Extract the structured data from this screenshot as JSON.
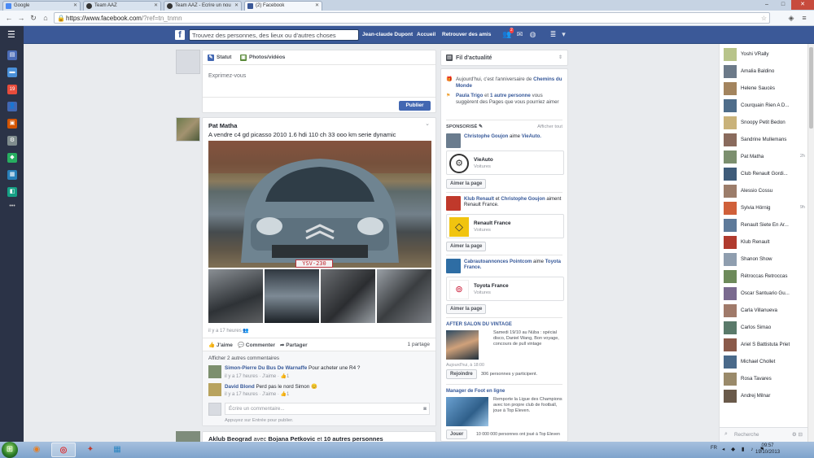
{
  "browser": {
    "tabs": [
      {
        "label": "Google",
        "icon": "google-icon",
        "active": false
      },
      {
        "label": "Team AAZ",
        "icon": "team-icon",
        "active": false
      },
      {
        "label": "Team AAZ - Ecrire un nou",
        "icon": "team-icon",
        "active": false
      },
      {
        "label": "(2) Facebook",
        "icon": "facebook-icon",
        "active": true
      }
    ],
    "url_host": "https://www.facebook.com",
    "url_path": "/?ref=tn_tnmn"
  },
  "topbar": {
    "search_placeholder": "Trouvez des personnes, des lieux ou d'autres choses",
    "user_name": "Jean-claude Dupont",
    "home_label": "Accueil",
    "find_friends_label": "Retrouver des amis",
    "friend_requests_count": "2"
  },
  "composer": {
    "tab_status": "Statut",
    "tab_photos": "Photos/vidéos",
    "placeholder": "Exprimez-vous",
    "publish_label": "Publier"
  },
  "post": {
    "author": "Pat Matha",
    "text": "A vendre c4 gd picasso 2010 1.6 hdi 110 ch 33 ooo km serie dynamic",
    "plate": "YSV-230",
    "time": "il y a 17 heures",
    "like_label": "J'aime",
    "comment_label": "Commenter",
    "share_label": "Partager",
    "share_count": "1 partage",
    "show_more_comments": "Afficher 2 autres commentaires",
    "comments": [
      {
        "author": "Simon-Pierre Du Bus De Warnaffe",
        "text": "Pour acheter une R4 ?",
        "time": "il y a 17 heures",
        "like": "J'aime",
        "likes": "1"
      },
      {
        "author": "David Blond",
        "text": "Perd pas le nord Simon 😊",
        "time": "il y a 17 heures",
        "like": "J'aime",
        "likes": "1"
      }
    ],
    "comment_placeholder": "Écrire un commentaire...",
    "enter_hint": "Appuyez sur Entrée pour publier."
  },
  "post2": {
    "author": "Aklub Beograd",
    "with_text": "avec",
    "tagged": "Bojana Petkovic",
    "and_text": "et",
    "others": "10 autres personnes"
  },
  "feed": {
    "title": "Fil d'actualité",
    "birthday_pre": "Aujourd'hui, c'est l'anniversaire de",
    "birthday_name": "Chemins du Monde",
    "suggest_name": "Paula Trigo",
    "suggest_mid": "et",
    "suggest_others": "1 autre personne",
    "suggest_rest": "vous suggèrent des Pages que vous pourriez aimer",
    "sponsored_label": "SPONSORISÉ",
    "show_all": "Afficher tout",
    "pages": [
      {
        "line_a": "Christophe Goujon",
        "line_verb": "aime",
        "line_b": "VieAuto.",
        "line_b2": "",
        "name": "VieAuto",
        "category": "Voitures",
        "like": "Aimer la page"
      },
      {
        "line_a": "Klub Renault",
        "line_verb": "et",
        "line_b": "Christophe Goujon",
        "line_b2": "aiment Renault France.",
        "name": "Renault France",
        "category": "Voitures",
        "like": "Aimer la page"
      },
      {
        "line_a": "Cabrautoannonces Pointcom",
        "line_verb": "aime",
        "line_b": "Toyota France.",
        "line_b2": "",
        "name": "Toyota France",
        "category": "Voitures",
        "like": "Aimer la page"
      }
    ],
    "event_title": "AFTER SALON DU VINTAGE",
    "event_desc": "Samedi 19/10 au Nüba : spécial disco, Daniel Wang, Bon voyage, concours de pull vintage",
    "event_time": "Aujourd'hui, à 18:00",
    "event_join": "Rejoindre",
    "event_participants": "306 personnes y participent.",
    "game_title": "Manager de Foot en ligne",
    "game_desc": "Remporte la Ligue des Champions avec ton propre club de football, joue à Top Eleven.",
    "game_play": "Jouer",
    "game_players": "10 000 000 personnes ont joué à Top Eleven"
  },
  "chat": {
    "friends": [
      {
        "name": "Yoshi VRally",
        "time": ""
      },
      {
        "name": "Amalia Baldino",
        "time": ""
      },
      {
        "name": "Helene Saucès",
        "time": ""
      },
      {
        "name": "Courquain Rien A D...",
        "time": ""
      },
      {
        "name": "Snoopy Petit Bedon",
        "time": ""
      },
      {
        "name": "Sandrine Mullemans",
        "time": ""
      },
      {
        "name": "Pat Matha",
        "time": "2h"
      },
      {
        "name": "Club Renault Gordi...",
        "time": ""
      },
      {
        "name": "Alessio Cossu",
        "time": ""
      },
      {
        "name": "Sylvia Hörnig",
        "time": "9h"
      },
      {
        "name": "Renault Siete En Ar...",
        "time": ""
      },
      {
        "name": "Klub Renault",
        "time": ""
      },
      {
        "name": "Shanon Show",
        "time": ""
      },
      {
        "name": "Rétroccas Retroccas",
        "time": ""
      },
      {
        "name": "Oscar Santuario Gu...",
        "time": ""
      },
      {
        "name": "Carla Villanueva",
        "time": ""
      },
      {
        "name": "Carlos Simao",
        "time": ""
      },
      {
        "name": "Ariel S Battistuta Prieto",
        "time": ""
      },
      {
        "name": "Michael Chollet",
        "time": ""
      },
      {
        "name": "Rosa Tavares",
        "time": ""
      },
      {
        "name": "Andrej Milnar",
        "time": ""
      }
    ],
    "search_placeholder": "Recherche"
  },
  "taskbar": {
    "lang": "FR",
    "time": "09:57",
    "date": "19/10/2013"
  },
  "colors": {
    "facebook_blue": "#3b5998",
    "link_blue": "#365899",
    "renault_yellow": "#f1c40f",
    "toyota_red": "#c8102e"
  }
}
